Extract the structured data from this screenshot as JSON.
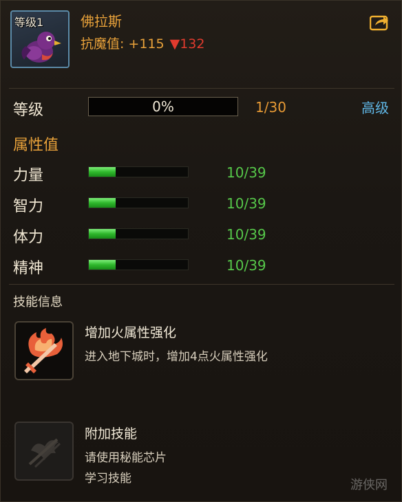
{
  "pet": {
    "level_badge": "等级1",
    "name": "佛拉斯",
    "resist_label": "抗魔值:",
    "resist_plus": "+115",
    "resist_down": "▼132"
  },
  "share_icon": "share-icon",
  "experience": {
    "label": "等级",
    "percent": "0%",
    "count": "1/30",
    "advanced": "高级"
  },
  "attributes": {
    "title": "属性值",
    "items": [
      {
        "label": "力量",
        "value": "10/39",
        "fill": 0.27
      },
      {
        "label": "智力",
        "value": "10/39",
        "fill": 0.27
      },
      {
        "label": "体力",
        "value": "10/39",
        "fill": 0.27
      },
      {
        "label": "精神",
        "value": "10/39",
        "fill": 0.27
      }
    ]
  },
  "skills": {
    "title": "技能信息",
    "items": [
      {
        "name": "增加火属性强化",
        "desc1": "进入地下城时，增加4点火属性强化",
        "desc2": "",
        "icon": "fire-sword-icon"
      },
      {
        "name": "附加技能",
        "desc1": "请使用秘能芯片",
        "desc2": "学习技能",
        "icon": "locked-skill-icon"
      }
    ]
  },
  "watermark": "游侠网",
  "colors": {
    "accent": "#e9a23a",
    "down": "#e23b2e",
    "stat": "#56c84a",
    "link": "#5fb7e6"
  }
}
